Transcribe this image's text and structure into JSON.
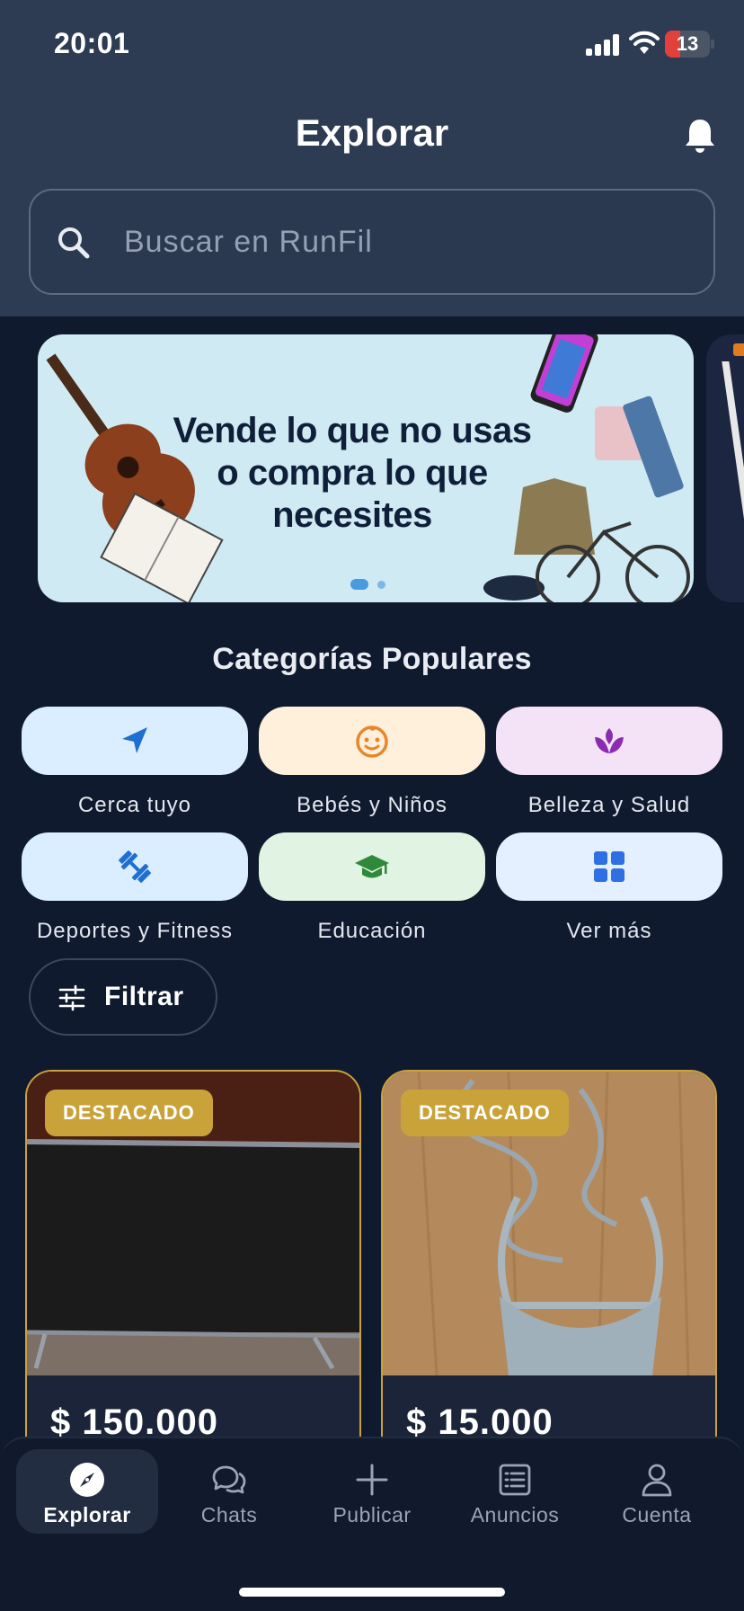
{
  "status_bar": {
    "time": "20:01",
    "battery": "13",
    "battery_level": 0.13
  },
  "header": {
    "title": "Explorar",
    "icons": {
      "notifications": "bell-icon"
    }
  },
  "search": {
    "placeholder": "Buscar en RunFil",
    "icon": "search-icon"
  },
  "banner": {
    "text": "Vende lo que no usas o compra lo que necesites",
    "active_slide": 1,
    "slide_count": 2
  },
  "categories": {
    "title": "Categorías Populares",
    "items": [
      {
        "label": "Cerca tuyo",
        "icon": "location-arrow-icon",
        "bg": "#dbeeff",
        "color": "#1f6fd1"
      },
      {
        "label": "Bebés y Niños",
        "icon": "baby-face-icon",
        "bg": "#fff0db",
        "color": "#e8862a"
      },
      {
        "label": "Belleza y Salud",
        "icon": "lotus-icon",
        "bg": "#f4e3f7",
        "color": "#8a2bb0"
      },
      {
        "label": "Deportes y Fitness",
        "icon": "dumbbell-icon",
        "bg": "#dbeeff",
        "color": "#1f6fd1"
      },
      {
        "label": "Educación",
        "icon": "graduation-cap-icon",
        "bg": "#e1f3e3",
        "color": "#2e8a3a"
      },
      {
        "label": "Ver más",
        "icon": "grid-icon",
        "bg": "#e4efff",
        "color": "#2f6fe4"
      }
    ]
  },
  "filter": {
    "label": "Filtrar",
    "icon": "sliders-icon"
  },
  "listings": [
    {
      "badge": "DESTACADO",
      "price": "$ 150.000"
    },
    {
      "badge": "DESTACADO",
      "price": "$ 15.000"
    }
  ],
  "nav": {
    "items": [
      {
        "label": "Explorar",
        "icon": "compass-icon",
        "active": true
      },
      {
        "label": "Chats",
        "icon": "chat-bubbles-icon",
        "active": false
      },
      {
        "label": "Publicar",
        "icon": "plus-icon",
        "active": false
      },
      {
        "label": "Anuncios",
        "icon": "list-icon",
        "active": false
      },
      {
        "label": "Cuenta",
        "icon": "user-icon",
        "active": false
      }
    ]
  },
  "colors": {
    "header_bg": "#2d3b53",
    "page_bg": "#101a2e",
    "featured_gold": "#c9a33a"
  }
}
